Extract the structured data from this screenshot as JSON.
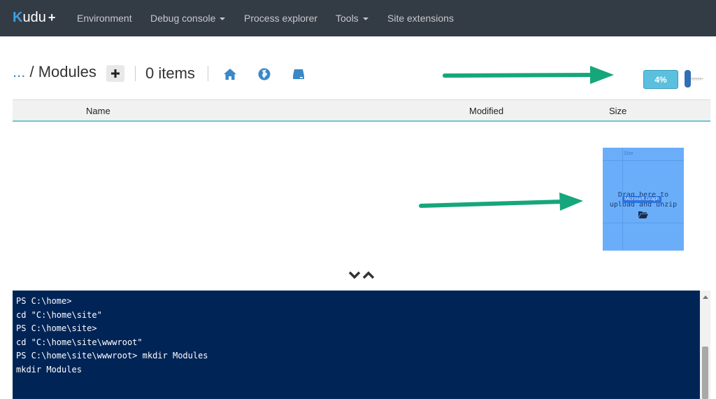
{
  "navbar": {
    "brand": "udu",
    "brand_k": "K",
    "brand_plus": "+",
    "items": [
      {
        "label": "Environment"
      },
      {
        "label": "Debug console"
      },
      {
        "label": "Process explorer"
      },
      {
        "label": "Tools"
      },
      {
        "label": "Site extensions"
      }
    ]
  },
  "breadcrumb": {
    "ellipsis": "...",
    "separator": "/",
    "current": "Modules"
  },
  "items_count": "0 items",
  "icons": {
    "add": "plus-icon",
    "home": "home-icon",
    "globe": "globe-icon",
    "drive": "drive-icon"
  },
  "upload": {
    "progress_label": "4%",
    "progress_value": 4
  },
  "table": {
    "columns": [
      "Name",
      "Modified",
      "Size"
    ]
  },
  "drop_zone": {
    "header": "Size",
    "line1": "Drag here to",
    "line2": "upload and unzip",
    "drag_tag": "Microsoft.Graph"
  },
  "colors": {
    "navbar_bg": "#333b45",
    "accent_blue": "#3a88c8",
    "console_bg": "#012456",
    "arrow_green": "#16a67c",
    "badge": "#5bc0de"
  },
  "console": {
    "lines": [
      "PS C:\\home>",
      "cd \"C:\\home\\site\"",
      "PS C:\\home\\site>",
      "cd \"C:\\home\\site\\wwwroot\"",
      "PS C:\\home\\site\\wwwroot> mkdir Modules",
      "mkdir Modules"
    ]
  }
}
